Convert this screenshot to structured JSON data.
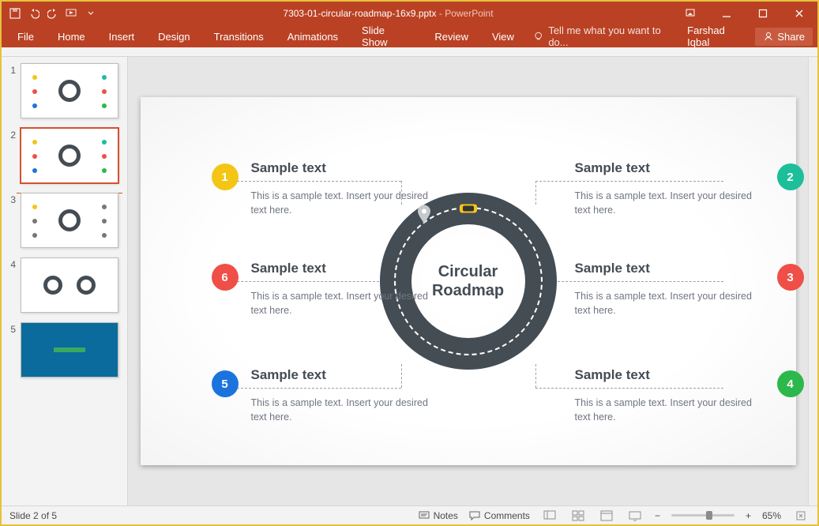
{
  "window": {
    "filename": "7303-01-circular-roadmap-16x9.pptx",
    "appname": "PowerPoint",
    "user": "Farshad Iqbal",
    "share": "Share"
  },
  "ribbon": {
    "tabs": [
      "File",
      "Home",
      "Insert",
      "Design",
      "Transitions",
      "Animations",
      "Slide Show",
      "Review",
      "View"
    ],
    "tell": "Tell me what you want to do..."
  },
  "slide": {
    "center_top": "Circular",
    "center_bottom": "Roadmap",
    "items": [
      {
        "num": "1",
        "title": "Sample text",
        "body": "This is a sample text. Insert your desired text here.",
        "color": "c-yellow"
      },
      {
        "num": "2",
        "title": "Sample text",
        "body": "This is a sample text. Insert your desired text here.",
        "color": "c-teal"
      },
      {
        "num": "3",
        "title": "Sample text",
        "body": "This is a sample text. Insert your desired text here.",
        "color": "c-redor"
      },
      {
        "num": "4",
        "title": "Sample text",
        "body": "This is a sample text. Insert your desired text here.",
        "color": "c-green"
      },
      {
        "num": "5",
        "title": "Sample text",
        "body": "This is a sample text. Insert your desired text here.",
        "color": "c-blue"
      },
      {
        "num": "6",
        "title": "Sample text",
        "body": "This is a sample text. Insert your desired text here.",
        "color": "c-red"
      }
    ]
  },
  "thumbs": {
    "count": 5,
    "selected": 2
  },
  "status": {
    "slide": "Slide 2 of 5",
    "notes": "Notes",
    "comments": "Comments",
    "zoom": "65%"
  }
}
